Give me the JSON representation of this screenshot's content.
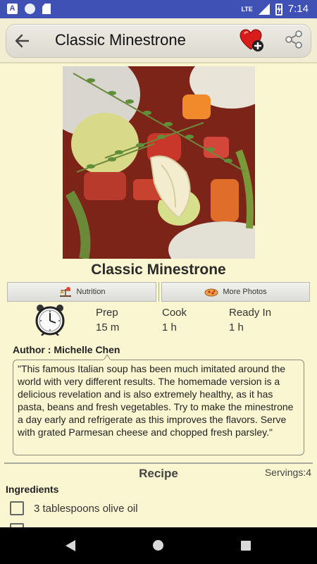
{
  "status_bar": {
    "time": "7:14",
    "network": "LTE",
    "notification_icons": [
      "app-a-icon",
      "circle-icon",
      "sd-card-icon"
    ],
    "system_icons": [
      "signal-icon",
      "battery-charging-icon"
    ]
  },
  "toolbar": {
    "title": "Classic Minestrone",
    "back_icon": "arrow-left-icon",
    "favorite_icon": "heart-plus-icon",
    "share_icon": "share-icon"
  },
  "recipe": {
    "name": "Classic Minestrone",
    "image_alt": "bowl-of-minestrone-soup-with-thyme"
  },
  "tabs": {
    "nutrition_label": "Nutrition",
    "photos_label": "More Photos"
  },
  "times": {
    "prep_label": "Prep",
    "prep_value": "15 m",
    "cook_label": "Cook",
    "cook_value": "1 h",
    "ready_label": "Ready In",
    "ready_value": "1 h"
  },
  "author": {
    "label": "Author : Michelle Chen"
  },
  "description": "\"This famous Italian soup has been much imitated around the world with very different results.  The homemade version is a delicious revelation and is also extremely healthy, as it has pasta, beans and fresh vegetables. Try to make the minestrone a day early and refrigerate as this improves the flavors. Serve with grated Parmesan cheese and chopped fresh parsley.\"",
  "recipe_section": {
    "header": "Recipe",
    "servings": "Servings:4",
    "ingredients_header": "Ingredients",
    "ingredients": [
      {
        "text": "3 tablespoons olive oil",
        "checked": false
      },
      {
        "text": "",
        "checked": false
      }
    ]
  },
  "colors": {
    "status_bar": "#3f51b5",
    "page_background": "#fbf6d2",
    "accent_heart": "#d81b1b"
  }
}
